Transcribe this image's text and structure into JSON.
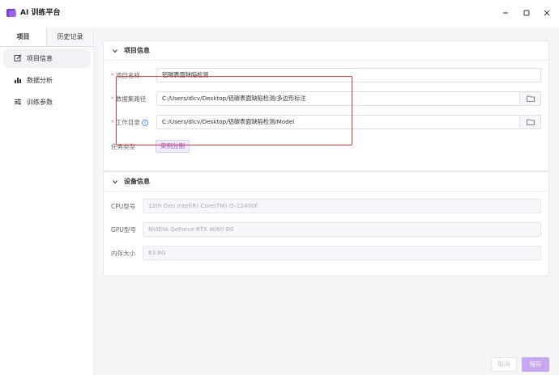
{
  "window": {
    "title": "AI 训练平台",
    "controls": {
      "minimize": "minimize-icon",
      "maximize": "maximize-icon",
      "close": "close-icon"
    }
  },
  "sidebar": {
    "tabs": [
      {
        "label": "项目",
        "active": true
      },
      {
        "label": "历史记录",
        "active": false
      }
    ],
    "items": [
      {
        "label": "项目信息",
        "icon": "edit-icon",
        "active": true
      },
      {
        "label": "数据分析",
        "icon": "bar-chart-icon",
        "active": false
      },
      {
        "label": "训练参数",
        "icon": "sliders-icon",
        "active": false
      }
    ]
  },
  "project": {
    "header": "项目信息",
    "name_label": "项目名称",
    "name_value": "铝碳表面缺陷检测",
    "dataset_label": "数据集路径",
    "dataset_value": "C:/Users/dlcv/Desktop/铝碳表面缺陷检测/多边形标注",
    "workdir_label": "工作目录",
    "workdir_value": "C:/Users/dlcv/Desktop/铝碳表面缺陷检测/Model",
    "task_label": "任务类型",
    "task_value": "实例分割",
    "required_mark": "*",
    "help_mark": "?"
  },
  "device": {
    "header": "设备信息",
    "cpu_label": "CPU型号",
    "cpu_value": "12th Gen Intel(R) Core(TM) i5-12400F",
    "gpu_label": "GPU型号",
    "gpu_value": "NVIDIA GeForce RTX 4060 8G",
    "mem_label": "内存大小",
    "mem_value": "63.8G"
  },
  "footer": {
    "cancel_label": "取消",
    "save_label": "保存"
  },
  "colors": {
    "accent": "#7c3fd6",
    "highlight": "#e53935",
    "required": "#f56c6c",
    "save_button": "#c9a7f0"
  }
}
